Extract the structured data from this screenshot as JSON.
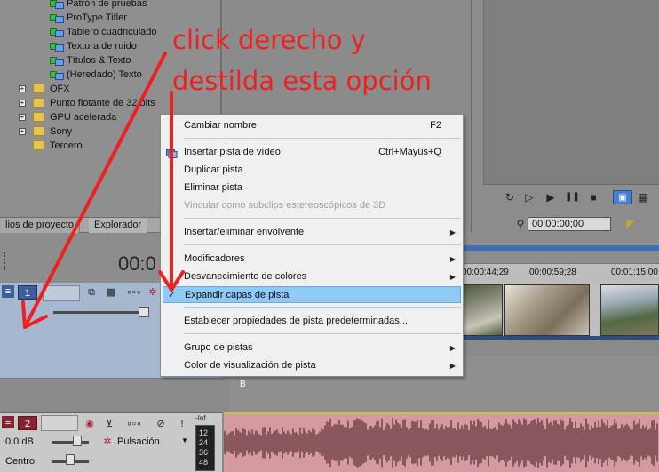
{
  "tree": {
    "items": [
      {
        "label": "Patrón de pruebas",
        "type": "plugin"
      },
      {
        "label": "ProType Titler",
        "type": "plugin"
      },
      {
        "label": "Tablero cuadriculado",
        "type": "plugin"
      },
      {
        "label": "Textura de ruido",
        "type": "plugin"
      },
      {
        "label": "Títulos & Texto",
        "type": "plugin"
      },
      {
        "label": "(Heredado) Texto",
        "type": "plugin"
      },
      {
        "label": "OFX",
        "type": "folder",
        "expander": "+"
      },
      {
        "label": "Punto flotante de 32 bits",
        "type": "folder",
        "expander": "+"
      },
      {
        "label": "GPU acelerada",
        "type": "folder",
        "expander": "+"
      },
      {
        "label": "Sony",
        "type": "folder",
        "expander": "+"
      },
      {
        "label": "Tercero",
        "type": "folder",
        "expander": ""
      }
    ]
  },
  "tabs": {
    "project": "lios de proyecto",
    "explorer": "Explorador"
  },
  "timeline": {
    "timecode_partial": "00:0",
    "preview_timecode": "00:00:00;00",
    "ruler": [
      "00:00:44;29",
      "00:00:59;28",
      "00:01:15:00"
    ],
    "marker": "B"
  },
  "video_track": {
    "number": "1"
  },
  "audio_track": {
    "number": "2",
    "volume": "0,0 dB",
    "pan": "Centro",
    "mode": "Pulsación",
    "meter_label": "-Inf.",
    "meter_values": [
      "12",
      "24",
      "36",
      "48"
    ]
  },
  "context_menu": {
    "items": [
      {
        "label": "Cambiar nombre",
        "shortcut": "F2",
        "key": "C"
      },
      {
        "label": "Insertar pista de vídeo",
        "shortcut": "Ctrl+Mayús+Q",
        "icon": true
      },
      {
        "label": "Duplicar pista"
      },
      {
        "label": "Eliminar pista"
      },
      {
        "label": "Vincular como subclips estereoscópicos de 3D",
        "disabled": true
      },
      {
        "label": "Insertar/eliminar envolvente",
        "submenu": true
      },
      {
        "label": "Modificadores",
        "submenu": true
      },
      {
        "label": "Desvanecimiento de colores",
        "submenu": true
      },
      {
        "label": "Expandir capas de pista",
        "checked": true,
        "highlight": true
      },
      {
        "label": "Establecer propiedades de pista predeterminadas..."
      },
      {
        "label": "Grupo de pistas",
        "submenu": true
      },
      {
        "label": "Color de visualización de pista",
        "submenu": true
      }
    ]
  },
  "annotation": {
    "line1": "click derecho y",
    "line2": "destilda esta opción",
    "color": "#ef2020"
  },
  "icons": {
    "play": "▶",
    "loop": "↻",
    "stop": "■",
    "pause": "❚❚",
    "submenu": "▶",
    "check": "✓"
  }
}
